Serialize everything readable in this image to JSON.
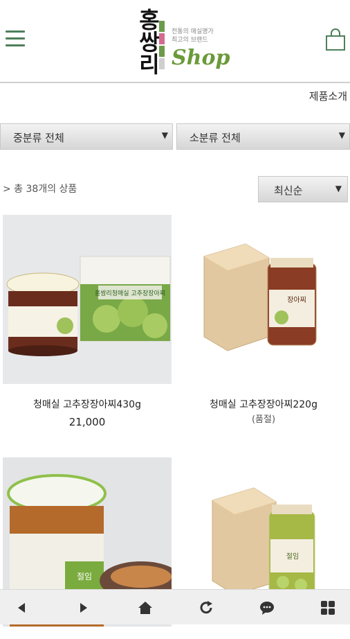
{
  "header": {
    "logo_chars": "홍쌍리",
    "logo_tagline_1": "전통의 매실명가",
    "logo_tagline_2": "최고의 브랜드",
    "logo_shop": "Shop"
  },
  "breadcrumb": "제품소개",
  "filters": {
    "category_mid": "중분류 전체",
    "category_sub": "소분류 전체"
  },
  "list": {
    "count_text": "> 총 38개의 상품",
    "sort_value": "최신순"
  },
  "products": [
    {
      "name": "청매실 고추장장아찌430g",
      "price": "21,000",
      "note": ""
    },
    {
      "name": "청매실 고추장장아찌220g",
      "price": "",
      "note": "(품절)"
    },
    {
      "name": "",
      "price": "",
      "note": ""
    },
    {
      "name": "",
      "price": "",
      "note": ""
    }
  ],
  "product_labels": {
    "box_1": "홍쌍리청매실 고추장장아찌",
    "jar_2": "장아찌",
    "jar_3": "절임",
    "jar_4": "절임"
  },
  "colors": {
    "brand_green": "#6b9a3a",
    "menu_green": "#4d7f5a",
    "bar_bg": "#efefef"
  },
  "icons": [
    "menu-icon",
    "shopping-bag-icon",
    "back-icon",
    "forward-icon",
    "home-icon",
    "refresh-icon",
    "chat-icon",
    "grid-icon"
  ]
}
